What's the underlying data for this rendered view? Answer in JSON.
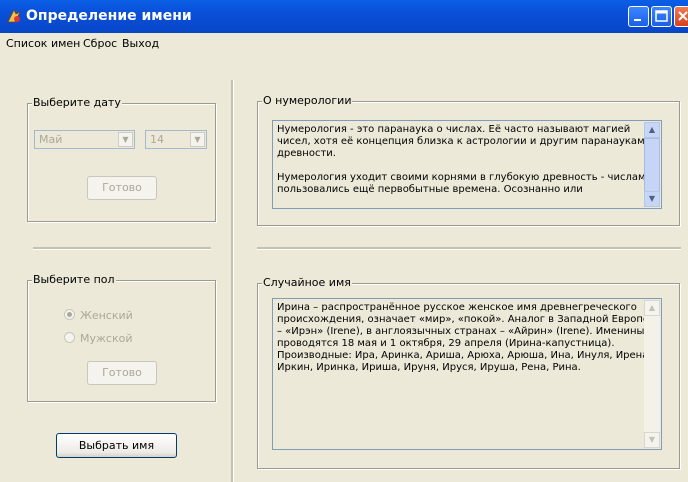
{
  "window": {
    "title": "Определение имени"
  },
  "menu": {
    "items": [
      "Список имен",
      "Сброс",
      "Выход"
    ]
  },
  "date_group": {
    "legend": "Выберите дату",
    "month": "Май",
    "day": "14",
    "ready_label": "Готово"
  },
  "gender_group": {
    "legend": "Выберите пол",
    "options": [
      "Женский",
      "Мужской"
    ],
    "selected": "Женский",
    "ready_label": "Готово"
  },
  "pick_button": "Выбрать имя",
  "numerology": {
    "legend": "О нумерологии",
    "text": "Нумерология - это паранаука о числах. Её часто называют магией\nчисел, хотя её концепция близка к астрологии и другим паранаукам\nдревности.\n\nНумерология уходит своими корнями в глубокую древность - числами\nпользовались ещё первобытные времена. Осознанно или"
  },
  "random_name": {
    "legend": "Случайное имя",
    "text": "Ирина – распространённое русское женское имя древнегреческого\nпроисхождения, означает «мир», «покой». Аналог в Западной Европе\n– «Ирэн» (Irene), в англоязычных странах – «Айрин» (Irene). Именины\nпроводятся 18 мая и 1 октября, 29 апреля (Ирина-капустница).\nПроизводные: Ира, Аринка, Ариша, Арюха, Арюша, Ина, Инуля, Ирена,\nИркин, Иринка, Ириша, Ируня, Ируся, Ирушa, Рена, Рина."
  },
  "colors": {
    "titlebar": "#0a4fd8",
    "window_bg": "#ece9d8"
  }
}
